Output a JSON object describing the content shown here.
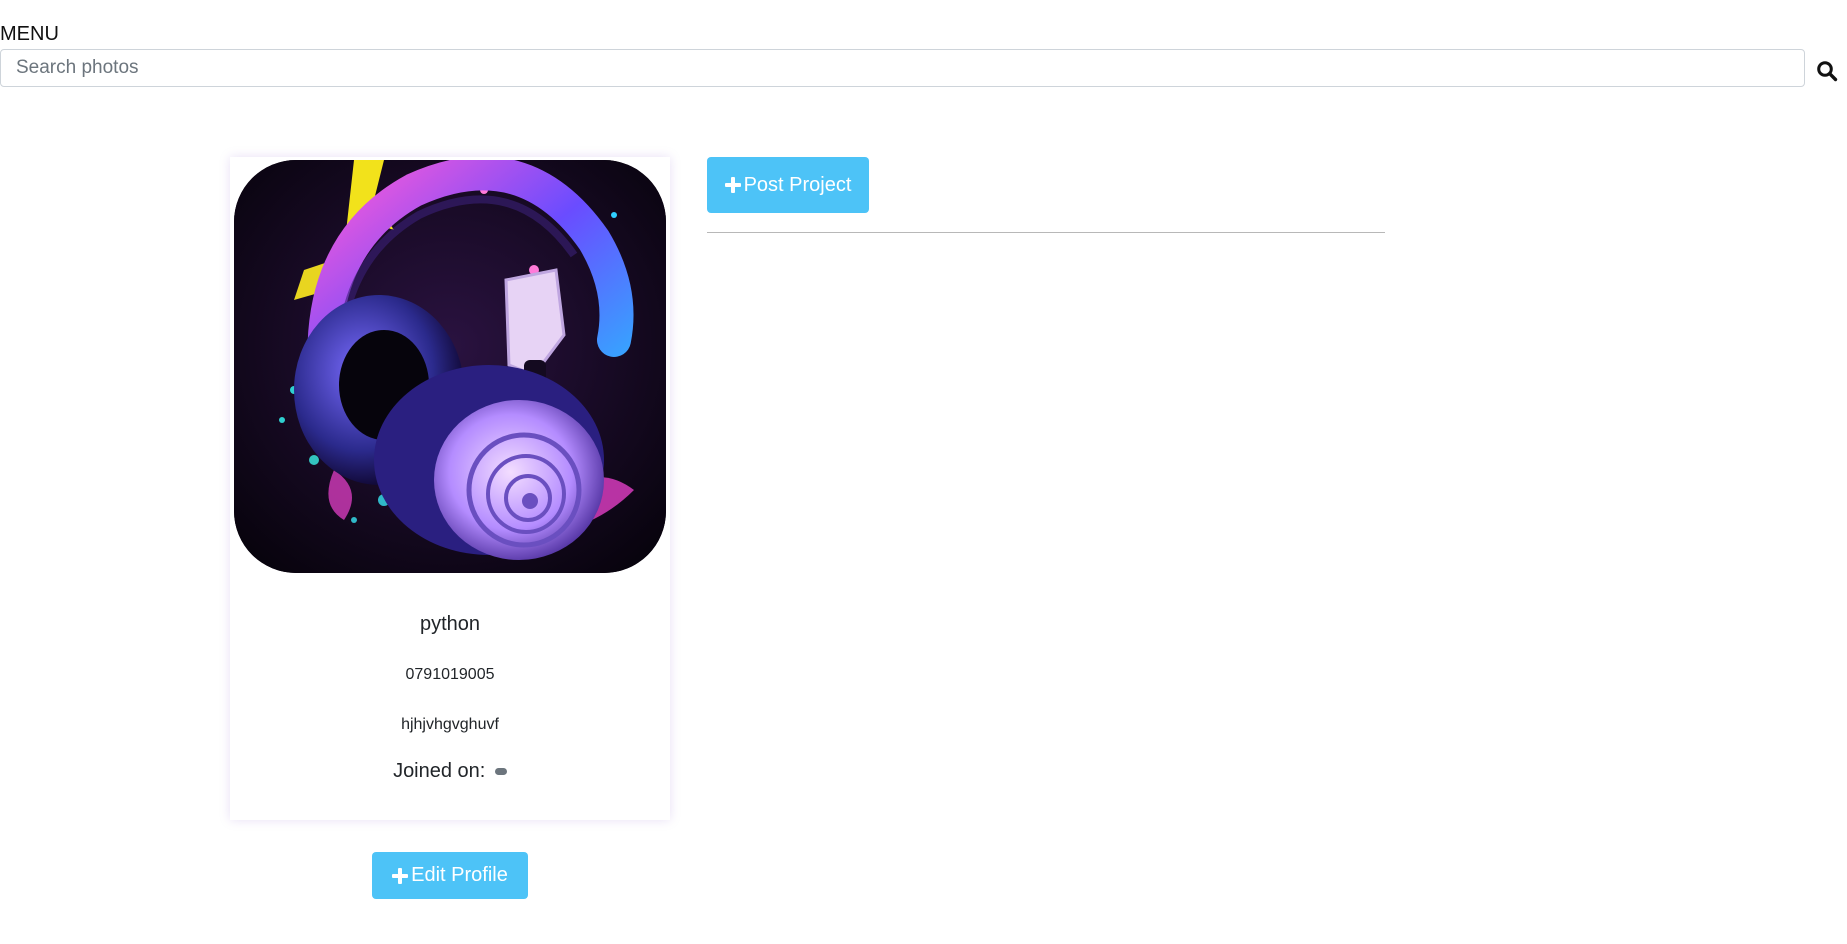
{
  "header": {
    "menu_label": "MENU",
    "search": {
      "placeholder": "Search photos",
      "value": "",
      "button_icon": "search-icon"
    }
  },
  "profile": {
    "avatar_description_icon": "headphones-image",
    "name": "python",
    "phone": "0791019005",
    "bio": "hjhjvhgvghuvf",
    "joined_label": "Joined on:",
    "joined_value": "",
    "edit_button": {
      "label": "Edit Profile",
      "icon": "plus-icon"
    }
  },
  "projects": {
    "post_button": {
      "label": "Post Project",
      "icon": "plus-icon"
    }
  },
  "colors": {
    "accent_button": "#4dc3f7",
    "card_shadow": "#966ed2",
    "badge": "#6c757d"
  }
}
